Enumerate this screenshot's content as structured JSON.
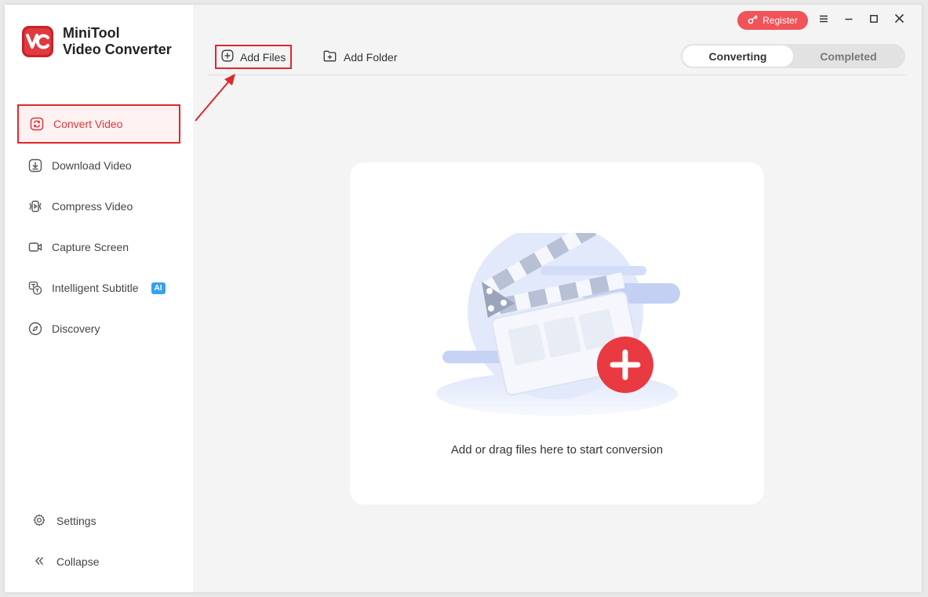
{
  "app": {
    "name_line1": "MiniTool",
    "name_line2": "Video Converter"
  },
  "sidebar": {
    "items": [
      {
        "label": "Convert Video",
        "icon": "convert-icon",
        "active": true
      },
      {
        "label": "Download Video",
        "icon": "download-icon"
      },
      {
        "label": "Compress Video",
        "icon": "compress-icon"
      },
      {
        "label": "Capture Screen",
        "icon": "camera-icon"
      },
      {
        "label": "Intelligent Subtitle",
        "icon": "subtitle-icon",
        "badge": "AI"
      },
      {
        "label": "Discovery",
        "icon": "compass-icon"
      }
    ],
    "bottom": [
      {
        "label": "Settings",
        "icon": "gear-icon"
      },
      {
        "label": "Collapse",
        "icon": "double-chevron-left-icon"
      }
    ]
  },
  "titlebar": {
    "register_label": "Register"
  },
  "toolbar": {
    "add_files_label": "Add Files",
    "add_folder_label": "Add Folder"
  },
  "tabs": [
    {
      "label": "Converting",
      "active": true
    },
    {
      "label": "Completed",
      "active": false
    }
  ],
  "drop_zone": {
    "message": "Add or drag files here to start conversion"
  },
  "colors": {
    "accent": "#e0373d",
    "register_bg": "#f0535a",
    "ai_badge": "#33a2f0"
  }
}
